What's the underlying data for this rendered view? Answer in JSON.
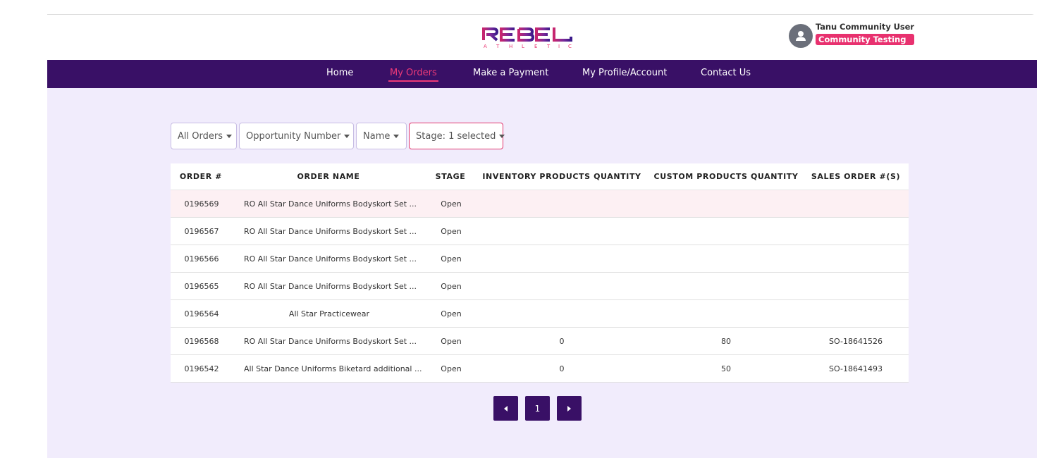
{
  "brand": {
    "logo_word": "REBEL",
    "logo_sub": "ATHLETIC",
    "primary": "#391066",
    "accent": "#e8316f"
  },
  "user": {
    "name": "Tanu Community User",
    "role": "Community Testing",
    "icon": "user-avatar-icon"
  },
  "nav": {
    "items": [
      {
        "label": "Home"
      },
      {
        "label": "My Orders",
        "active": true
      },
      {
        "label": "Make a Payment"
      },
      {
        "label": "My Profile/Account"
      },
      {
        "label": "Contact Us"
      }
    ]
  },
  "filters": [
    {
      "label": "All Orders"
    },
    {
      "label": "Opportunity Number"
    },
    {
      "label": "Name"
    },
    {
      "label": "Stage: 1 selected"
    }
  ],
  "table": {
    "columns": [
      "ORDER #",
      "ORDER NAME",
      "STAGE",
      "INVENTORY PRODUCTS QUANTITY",
      "CUSTOM PRODUCTS QUANTITY",
      "SALES ORDER #(S)"
    ],
    "rows": [
      {
        "order": "0196569",
        "name": "RO All Star Dance Uniforms Bodyskort Set ...",
        "stage": "Open",
        "inv": "",
        "custom": "",
        "so": ""
      },
      {
        "order": "0196567",
        "name": "RO All Star Dance Uniforms Bodyskort Set ...",
        "stage": "Open",
        "inv": "",
        "custom": "",
        "so": ""
      },
      {
        "order": "0196566",
        "name": "RO All Star Dance Uniforms Bodyskort Set ...",
        "stage": "Open",
        "inv": "",
        "custom": "",
        "so": ""
      },
      {
        "order": "0196565",
        "name": "RO All Star Dance Uniforms Bodyskort Set ...",
        "stage": "Open",
        "inv": "",
        "custom": "",
        "so": ""
      },
      {
        "order": "0196564",
        "name": "All Star Practicewear",
        "stage": "Open",
        "inv": "",
        "custom": "",
        "so": ""
      },
      {
        "order": "0196568",
        "name": "RO All Star Dance Uniforms Bodyskort Set ...",
        "stage": "Open",
        "inv": "0",
        "custom": "80",
        "so": "SO-18641526"
      },
      {
        "order": "0196542",
        "name": "All Star Dance Uniforms Biketard additional ...",
        "stage": "Open",
        "inv": "0",
        "custom": "50",
        "so": "SO-18641493"
      }
    ]
  },
  "pagination": {
    "current_page": "1",
    "prev_icon": "chevron-left-icon",
    "next_icon": "chevron-right-icon"
  }
}
